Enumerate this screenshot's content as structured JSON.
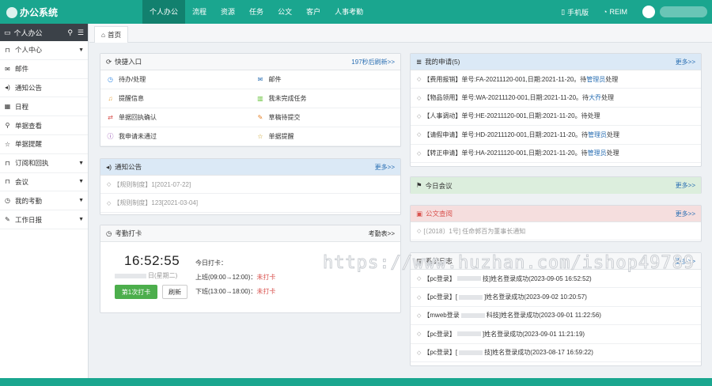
{
  "header": {
    "app_title": "办公系统",
    "nav": [
      {
        "label": "个人办公",
        "active": true
      },
      {
        "label": "流程"
      },
      {
        "label": "资源"
      },
      {
        "label": "任务"
      },
      {
        "label": "公文"
      },
      {
        "label": "客户"
      },
      {
        "label": "人事考勤"
      }
    ],
    "mobile_label": "手机版",
    "reim_label": "REIM"
  },
  "sidebar": {
    "title": "个人办公",
    "items": [
      {
        "label": "个人中心",
        "icon": "bookmark-icon",
        "caret": true
      },
      {
        "label": "邮件",
        "icon": "envelope-icon",
        "caret": false
      },
      {
        "label": "通知公告",
        "icon": "volume-icon",
        "caret": false
      },
      {
        "label": "日程",
        "icon": "calendar-icon",
        "caret": false
      },
      {
        "label": "单据查看",
        "icon": "search-icon",
        "caret": false
      },
      {
        "label": "单据提醒",
        "icon": "star-icon",
        "caret": false
      },
      {
        "label": "订阅和回执",
        "icon": "bookmark-icon",
        "caret": true
      },
      {
        "label": "会议",
        "icon": "bookmark-icon",
        "caret": true
      },
      {
        "label": "我的考勤",
        "icon": "clock-icon",
        "caret": true
      },
      {
        "label": "工作日报",
        "icon": "edit-icon",
        "caret": true
      }
    ]
  },
  "tabs": {
    "home": "首页"
  },
  "quick": {
    "title": "快捷入口",
    "refresh": "197秒后刷新>>",
    "items": [
      {
        "label": "待办/处理",
        "icon": "clock-icon",
        "color": "#3a8ee6"
      },
      {
        "label": "邮件",
        "icon": "envelope-icon",
        "color": "#2a6fb3"
      },
      {
        "label": "提醒信息",
        "icon": "bell-icon",
        "color": "#e6a23c"
      },
      {
        "label": "我未完成任务",
        "icon": "book-icon",
        "color": "#67c23a"
      },
      {
        "label": "单据回执确认",
        "icon": "exchange-icon",
        "color": "#d9534f"
      },
      {
        "label": "草稿待提交",
        "icon": "edit-icon",
        "color": "#e67e22"
      },
      {
        "label": "我申请未通过",
        "icon": "info-icon",
        "color": "#8e44ad"
      },
      {
        "label": "单据提醒",
        "icon": "star-icon",
        "color": "#c9a227"
      }
    ]
  },
  "notice": {
    "title": "通知公告",
    "more": "更多>>",
    "items": [
      "【规则制度】1[2021-07-22]",
      "【规则制度】123[2021-03-04]"
    ]
  },
  "attendance": {
    "title": "考勤打卡",
    "more": "考勤表>>",
    "time": "16:52:55",
    "date": "日(星期二)",
    "today_label": "今日打卡：",
    "morning": "上班(09:00→12:00)：",
    "afternoon": "下班(13:00→18:00)：",
    "status": "未打卡",
    "punch_button": "第1次打卡",
    "refresh_button": "刷新"
  },
  "myapply": {
    "title": "我的申请(5)",
    "more": "更多>>",
    "items": [
      {
        "pre": "【费用报销】单号:FA-20211120-001,日期:2021-11-20。待",
        "link": "管理员",
        "post": "处理"
      },
      {
        "pre": "【物品领用】单号:WA-20211120-001,日期:2021-11-20。待",
        "link": "大乔",
        "post": "处理"
      },
      {
        "pre": "【人事调动】单号:HE-20211120-001,日期:2021-11-20。待处理",
        "link": "",
        "post": ""
      },
      {
        "pre": "【请假申请】单号:HD-20211120-001,日期:2021-11-20。待",
        "link": "管理员",
        "post": "处理"
      },
      {
        "pre": "【转正申请】单号:HA-20211120-001,日期:2021-11-20。待",
        "link": "管理员",
        "post": "处理"
      }
    ]
  },
  "meeting": {
    "title": "今日会议",
    "more": "更多>>"
  },
  "docs": {
    "title": "公文查阅",
    "more": "更多>>",
    "items": [
      "[〔2018〕1号] 任命郭百为董事长通知"
    ]
  },
  "syslog": {
    "title": "系统日志",
    "more": "更多>>",
    "items": [
      {
        "pre": "【pc登录】",
        "post": "技]姓名登录成功(2023-09-05 16:52:52)"
      },
      {
        "pre": "【pc登录】[",
        "post": "]姓名登录成功(2023-09-02 10:20:57)"
      },
      {
        "pre": "【mweb登录",
        "post": "科技]姓名登录成功(2023-09-01 11:22:56)"
      },
      {
        "pre": "【pc登录】",
        "post": "]姓名登录成功(2023-09-01 11:21:19)"
      },
      {
        "pre": "【pc登录】[",
        "post": "技]姓名登录成功(2023-08-17 16:59:22)"
      }
    ]
  },
  "watermark": "https://www.huzhan.com/ishop49789"
}
